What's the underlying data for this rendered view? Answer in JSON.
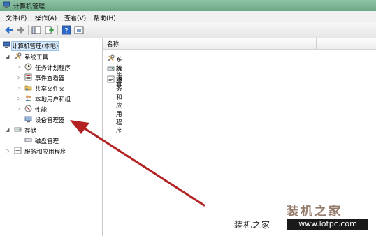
{
  "window": {
    "title": "计算机管理"
  },
  "menu": [
    {
      "label": "文件(F)"
    },
    {
      "label": "操作(A)"
    },
    {
      "label": "查看(V)"
    },
    {
      "label": "帮助(H)"
    }
  ],
  "tree": {
    "root": "计算机管理(本地)",
    "system_tools": "系统工具",
    "task_scheduler": "任务计划程序",
    "event_viewer": "事件查看器",
    "shared_folders": "共享文件夹",
    "local_users": "本地用户和组",
    "performance": "性能",
    "device_manager": "设备管理器",
    "storage": "存储",
    "disk_management": "磁盘管理",
    "services_apps": "服务和应用程序"
  },
  "content": {
    "column_name": "名称",
    "items": [
      "系统工具",
      "存储",
      "服务和应用程序"
    ]
  },
  "watermark": {
    "big": "装机之家",
    "small_cn": "装机之家",
    "url": "www.lotpc.com"
  },
  "colors": {
    "titlebar": "#79b394",
    "arrow": "#b22222",
    "selection": "#d6e8fa"
  }
}
